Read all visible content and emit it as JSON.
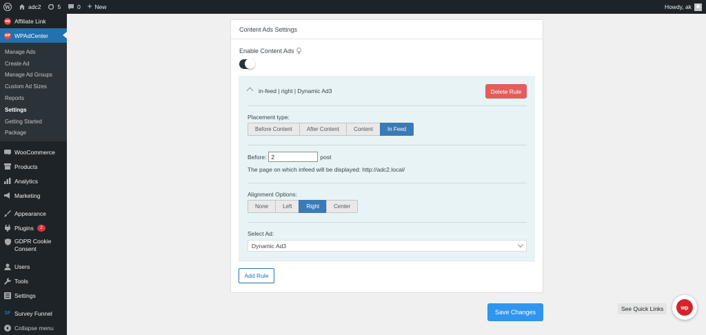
{
  "adminbar": {
    "site_name": "adc2",
    "updates_count": "5",
    "comments_count": "0",
    "new_label": "New",
    "howdy": "Howdy, ak"
  },
  "sidebar": {
    "top_item": "Affiliate Link",
    "current_item": "WPAdCenter",
    "current_icon_text": "WP",
    "submenu": [
      "Manage Ads",
      "Create Ad",
      "Manage Ad Groups",
      "Custom Ad Sizes",
      "Reports",
      "Settings",
      "Getting Started",
      "Package"
    ],
    "active_submenu": "Settings",
    "items": [
      {
        "label": "WooCommerce",
        "icon": "woo-icon"
      },
      {
        "label": "Products",
        "icon": "archive-icon"
      },
      {
        "label": "Analytics",
        "icon": "chart-icon"
      },
      {
        "label": "Marketing",
        "icon": "megaphone-icon"
      },
      {
        "label": "Appearance",
        "icon": "brush-icon"
      },
      {
        "label": "Plugins",
        "icon": "plug-icon",
        "badge": "2"
      },
      {
        "label": "GDPR Cookie Consent",
        "icon": "shield-icon"
      },
      {
        "label": "Users",
        "icon": "user-icon"
      },
      {
        "label": "Tools",
        "icon": "wrench-icon"
      },
      {
        "label": "Settings",
        "icon": "sliders-icon"
      },
      {
        "label": "Survey Funnel",
        "icon": "funnel-icon"
      },
      {
        "label": "Collapse menu",
        "icon": "collapse-icon"
      }
    ]
  },
  "card": {
    "title": "Content Ads Settings",
    "enable_label": "Enable Content Ads",
    "rule": {
      "title": "in-feed | right | Dynamic Ad3",
      "delete_label": "Delete Rule",
      "placement_label": "Placement type:",
      "placement_options": [
        "Before Content",
        "After Content",
        "Content",
        "In Feed"
      ],
      "placement_selected": "In Feed",
      "before_label": "Before:",
      "before_value": "2",
      "post_label": "post",
      "infeed_note": "The page on which infeed will be displayed: http://adc2.local/",
      "alignment_label": "Alignment Options:",
      "alignment_options": [
        "None",
        "Left",
        "Right",
        "Center"
      ],
      "alignment_selected": "Right",
      "select_label": "Select Ad:",
      "select_value": "Dynamic Ad3"
    },
    "add_rule_label": "Add Rule"
  },
  "save_label": "Save Changes",
  "quick_links_label": "See Quick Links",
  "fab_text": "wp"
}
